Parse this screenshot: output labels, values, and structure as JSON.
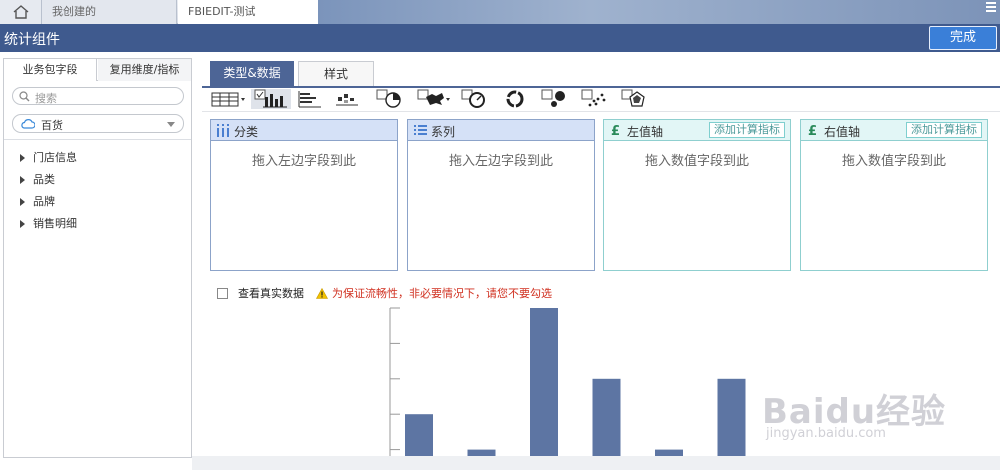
{
  "topbar": {
    "tabs": [
      {
        "label": "我创建的"
      },
      {
        "label": "FBIEDIT-测试"
      }
    ]
  },
  "titlebar": {
    "title": "统计组件",
    "done_label": "完成"
  },
  "left_panel": {
    "tabs": [
      {
        "label": "业务包字段"
      },
      {
        "label": "复用维度/指标"
      }
    ],
    "search": {
      "placeholder": "搜索"
    },
    "package": {
      "selected": "百货"
    },
    "tree": [
      {
        "label": "门店信息"
      },
      {
        "label": "品类"
      },
      {
        "label": "品牌"
      },
      {
        "label": "销售明细"
      }
    ]
  },
  "main": {
    "tabs": [
      {
        "label": "类型&数据",
        "active": true
      },
      {
        "label": "样式",
        "active": false
      }
    ],
    "chart_types": [
      {
        "icon": "table-type-icon",
        "selected": false
      },
      {
        "icon": "bar-chart-type-icon",
        "selected": true
      },
      {
        "icon": "horizontal-bar-type-icon",
        "selected": false
      },
      {
        "icon": "stacked-bar-type-icon",
        "selected": false
      },
      {
        "icon": "pie-chart-type-icon",
        "selected": false
      },
      {
        "icon": "map-type-icon",
        "selected": false
      },
      {
        "icon": "gauge-type-icon",
        "selected": false
      },
      {
        "icon": "donut-chart-type-icon",
        "selected": false
      },
      {
        "icon": "bubble-chart-type-icon",
        "selected": false
      },
      {
        "icon": "scatter-chart-type-icon",
        "selected": false
      },
      {
        "icon": "radar-chart-type-icon",
        "selected": false
      }
    ],
    "zones": [
      {
        "title": "分类",
        "hint": "拖入左边字段到此"
      },
      {
        "title": "系列",
        "hint": "拖入左边字段到此"
      },
      {
        "title": "左值轴",
        "hint": "拖入数值字段到此",
        "add_label": "添加计算指标"
      },
      {
        "title": "右值轴",
        "hint": "拖入数值字段到此",
        "add_label": "添加计算指标"
      }
    ],
    "real_data": {
      "label": "查看真实数据",
      "warning": "为保证流畅性，非必要情况下，请您不要勾选"
    }
  },
  "watermark": {
    "main": "Baidu经验",
    "sub": "jingyan.baidu.com"
  },
  "colors": {
    "accent": "#4d6596",
    "done_button": "#3a7fd8",
    "bar": "#5d75a3",
    "warning": "#d03020"
  },
  "chart_data": {
    "type": "bar",
    "categories": [
      "",
      "",
      "",
      "",
      "",
      ""
    ],
    "values": [
      2,
      1,
      5,
      3,
      1,
      3
    ],
    "ylim": [
      0,
      5
    ],
    "grid": false
  }
}
